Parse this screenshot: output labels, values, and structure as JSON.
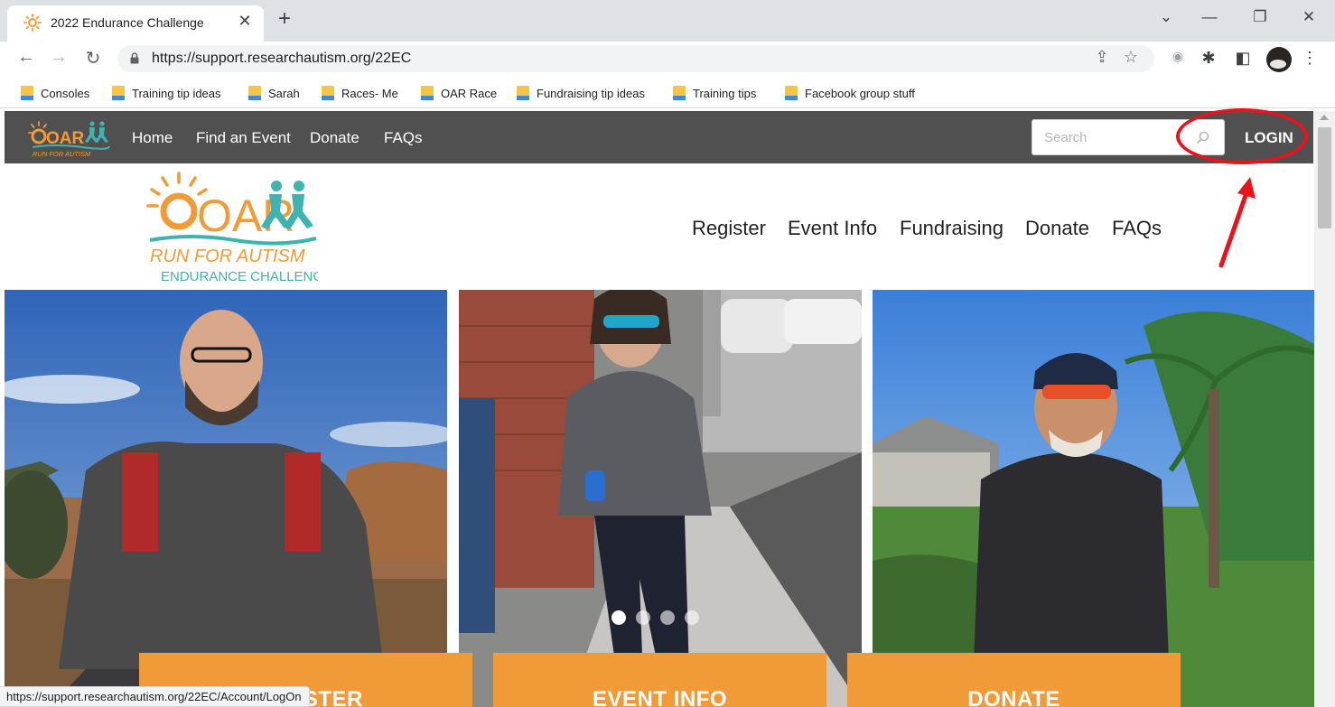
{
  "browser": {
    "tab": {
      "title": "2022 Endurance Challenge",
      "close_glyph": "✕"
    },
    "new_tab_glyph": "+",
    "window_controls": {
      "tab_search": "⌄",
      "minimize": "—",
      "restore": "❐",
      "close": "✕"
    },
    "nav": {
      "back": "←",
      "forward": "→",
      "reload": "↻"
    },
    "url": "https://support.researchautism.org/22EC",
    "omnibox_icons": {
      "share": "⇪",
      "bookmark_star": "☆"
    },
    "toolbar_icons": {
      "extension_shield": "◉",
      "extensions_puzzle": "✱",
      "side_panel": "◧",
      "menu": "⋮"
    },
    "bookmarks": [
      "Consoles",
      "Training tip ideas",
      "Sarah",
      "Races- Me",
      "OAR Race",
      "Fundraising tip ideas",
      "Training tips",
      "Facebook group stuff"
    ],
    "status_url": "https://support.researchautism.org/22EC/Account/LogOn"
  },
  "site": {
    "brand": {
      "logo_text": "OAR",
      "tagline": "RUN FOR AUTISM",
      "subtitle": "ENDURANCE CHALLENGE",
      "colors": {
        "orange": "#f19a38",
        "teal": "#3fb3b0",
        "topbar": "#505050"
      }
    },
    "top_nav": [
      "Home",
      "Find an Event",
      "Donate",
      "FAQs"
    ],
    "search_placeholder": "Search",
    "login_label": "LOGIN",
    "main_nav": [
      "Register",
      "Event Info",
      "Fundraising",
      "Donate",
      "FAQs"
    ],
    "carousel": {
      "slide_count": 4,
      "active_index": 0
    },
    "cta_buttons": [
      "REGISTER",
      "EVENT INFO",
      "DONATE"
    ]
  },
  "annotation": {
    "color": "#e8131c"
  }
}
